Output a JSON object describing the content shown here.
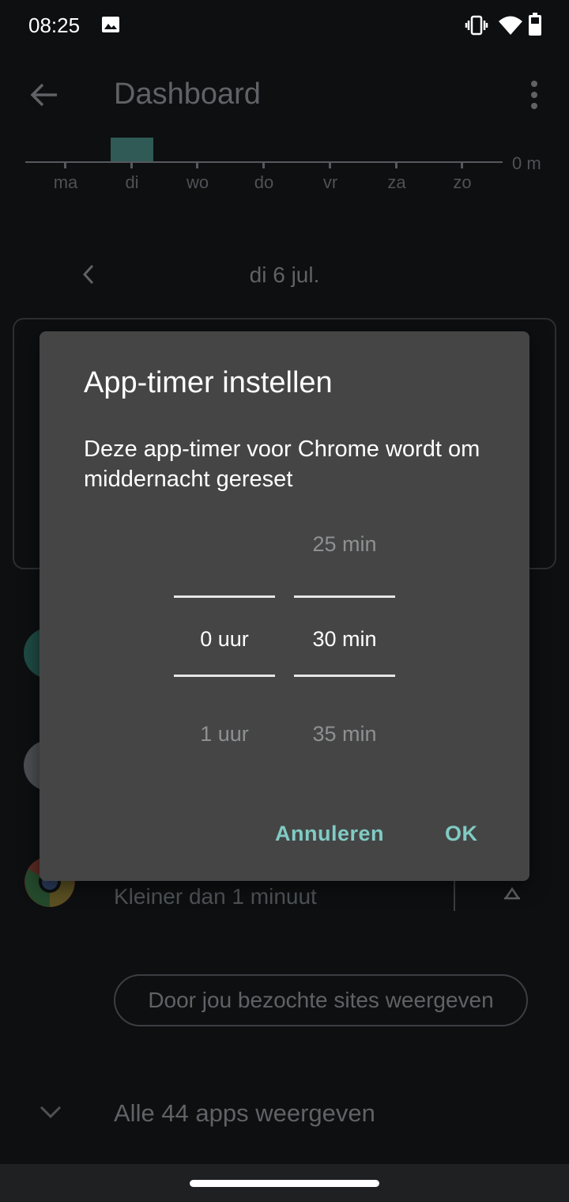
{
  "status_bar": {
    "time": "08:25"
  },
  "app_bar": {
    "title": "Dashboard"
  },
  "chart": {
    "days": [
      "ma",
      "di",
      "wo",
      "do",
      "vr",
      "za",
      "zo"
    ],
    "unit_label": "0 m",
    "selected_day": "di"
  },
  "date_nav": {
    "date": "di 6 jul."
  },
  "chrome_row": {
    "subtitle": "Kleiner dan 1 minuut"
  },
  "sites_button": {
    "label": "Door jou bezochte sites weergeven"
  },
  "all_apps": {
    "label": "Alle 44 apps weergeven"
  },
  "dialog": {
    "title": "App-timer instellen",
    "message": "Deze app-timer voor Chrome wordt om middernacht gereset",
    "hours_picker": {
      "prev": "",
      "selected": "0 uur",
      "next": "1 uur"
    },
    "minutes_picker": {
      "prev": "25 min",
      "selected": "30 min",
      "next": "35 min"
    },
    "cancel_label": "Annuleren",
    "ok_label": "OK"
  },
  "colors": {
    "background": "#0d0f10",
    "dialog": "#454545",
    "accent": "#80cbc4",
    "chart_bar": "#2f5a55"
  }
}
